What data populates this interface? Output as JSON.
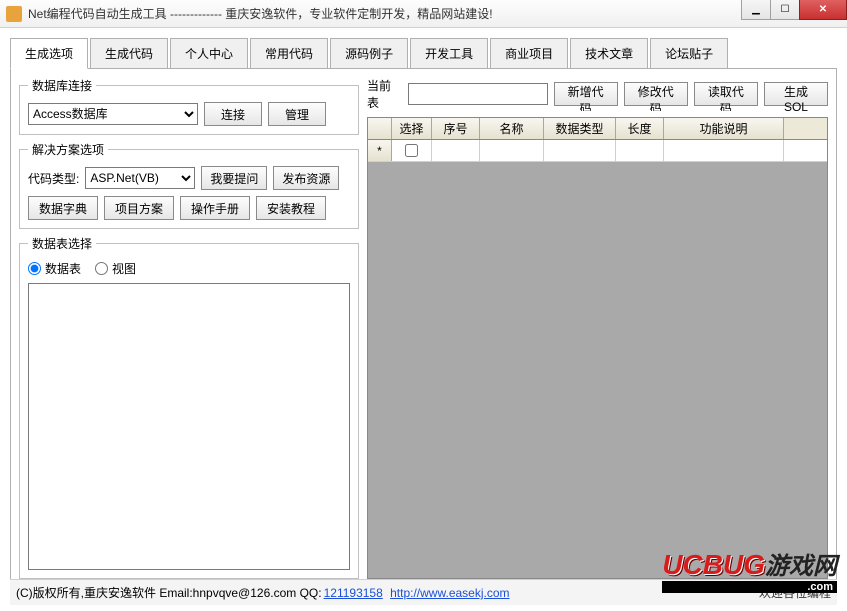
{
  "window": {
    "title": "Net编程代码自动生成工具 ------------- 重庆安逸软件，专业软件定制开发，精品网站建设!"
  },
  "tabs": {
    "items": [
      {
        "label": "生成选项"
      },
      {
        "label": "生成代码"
      },
      {
        "label": "个人中心"
      },
      {
        "label": "常用代码"
      },
      {
        "label": "源码例子"
      },
      {
        "label": "开发工具"
      },
      {
        "label": "商业项目"
      },
      {
        "label": "技术文章"
      },
      {
        "label": "论坛贴子"
      }
    ],
    "active_index": 0
  },
  "db_conn": {
    "legend": "数据库连接",
    "combo_value": "Access数据库",
    "connect_btn": "连接",
    "manage_btn": "管理"
  },
  "solution": {
    "legend": "解决方案选项",
    "code_type_label": "代码类型:",
    "code_type_value": "ASP.Net(VB)",
    "ask_btn": "我要提问",
    "publish_btn": "发布资源",
    "dict_btn": "数据字典",
    "project_btn": "项目方案",
    "manual_btn": "操作手册",
    "install_btn": "安装教程"
  },
  "table_select": {
    "legend": "数据表选择",
    "radio_table": "数据表",
    "radio_view": "视图"
  },
  "right_toolbar": {
    "current_table_label": "当前表",
    "current_table_value": "",
    "add_btn": "新增代码",
    "edit_btn": "修改代码",
    "read_btn": "读取代码",
    "gen_btn": "生成SQL"
  },
  "grid": {
    "columns": {
      "select": "选择",
      "seq": "序号",
      "name": "名称",
      "dtype": "数据类型",
      "len": "长度",
      "desc": "功能说明"
    },
    "newrow_marker": "*"
  },
  "statusbar": {
    "left_prefix": "(C)版权所有,重庆安逸软件 Email:",
    "email": "hnpvqve@126.com",
    "qq_label": " QQ:",
    "qq": "121193158",
    "sep": "   ",
    "url": "http://www.easekj.com",
    "right": "欢迎各位编程"
  },
  "watermark": {
    "brand": "UCBUG",
    "suffix": "游戏网",
    "com": ".com"
  }
}
